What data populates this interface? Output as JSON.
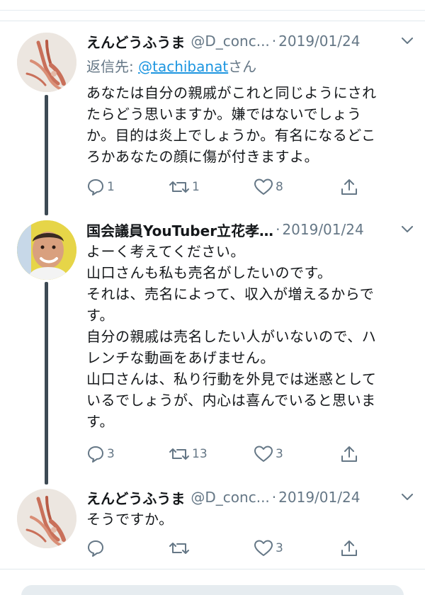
{
  "tweets": [
    {
      "name": "えんどうふうま",
      "handle": "@D_conc...",
      "date": "2019/01/24",
      "reply_prefix": "返信先: ",
      "reply_mention": "@tachibanat",
      "reply_suffix": "さん",
      "lines": [
        "あなたは自分の親戚がこれと同じようにされ",
        "たらどう思いますか。嫌ではないでしょう",
        "か。目的は炎上でしょうか。有名になるどこ",
        "ろかあなたの顔に傷が付きますよ。"
      ],
      "replies": "1",
      "retweets": "1",
      "likes": "8"
    },
    {
      "name": "国会議員YouTuber立花孝…",
      "handle": "",
      "date": "2019/01/24",
      "lines": [
        "よーく考えてください。",
        "山口さんも私も売名がしたいのです。",
        "それは、売名によって、収入が増えるからで",
        "す。",
        "自分の親戚は売名したい人がいないので、ハ",
        "レンチな動画をあげません。",
        "山口さんは、私り行動を外見では迷惑として",
        "いるでしょうが、内心は喜んでいると思いま",
        "す。"
      ],
      "replies": "3",
      "retweets": "13",
      "likes": "3"
    },
    {
      "name": "えんどうふうま",
      "handle": "@D_conc...",
      "date": "2019/01/24",
      "lines": [
        "そうですか。"
      ],
      "replies": "",
      "retweets": "",
      "likes": "3"
    }
  ],
  "icons": {
    "reply": "speech-bubble-icon",
    "retweet": "retweet-arrows-icon",
    "like": "heart-outline-icon",
    "share": "share-upload-icon",
    "more": "chevron-down-icon"
  },
  "colors": {
    "text": "#14171a",
    "secondary": "#657786",
    "link": "#1b95e0",
    "thread_line": "#3d4a54"
  }
}
